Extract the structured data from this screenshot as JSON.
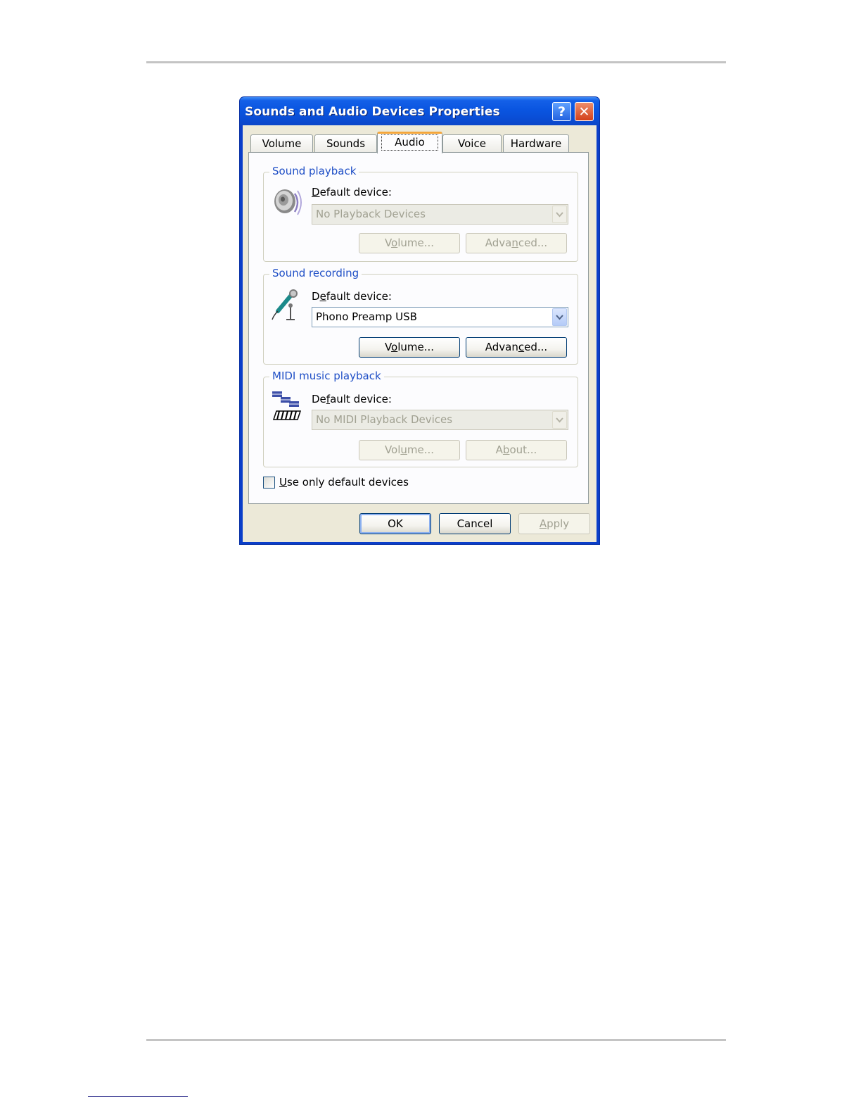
{
  "window": {
    "title": "Sounds and Audio Devices Properties",
    "help_glyph": "?",
    "close_glyph": "✕"
  },
  "tabs": [
    {
      "label": "Volume"
    },
    {
      "label": "Sounds"
    },
    {
      "label": "Audio",
      "active": true
    },
    {
      "label": "Voice"
    },
    {
      "label": "Hardware"
    }
  ],
  "sound_playback": {
    "title": "Sound playback",
    "icon": "speaker-icon",
    "label_mnemonic": "D",
    "label_rest": "efault device:",
    "device": "No Playback Devices",
    "volume_pre": "V",
    "volume_mnemonic": "o",
    "volume_post": "lume...",
    "advanced_pre": "Adva",
    "advanced_mnemonic": "n",
    "advanced_post": "ced...",
    "enabled": false
  },
  "sound_recording": {
    "title": "Sound recording",
    "icon": "microphone-icon",
    "label_pre": "D",
    "label_mnemonic": "e",
    "label_post": "fault device:",
    "device": "Phono Preamp USB",
    "volume_pre": "V",
    "volume_mnemonic": "o",
    "volume_post": "lume...",
    "advanced_pre": "Advan",
    "advanced_mnemonic": "c",
    "advanced_post": "ed...",
    "enabled": true
  },
  "midi_playback": {
    "title": "MIDI music playback",
    "icon": "midi-keyboard-icon",
    "label_pre": "De",
    "label_mnemonic": "f",
    "label_post": "ault device:",
    "device": "No MIDI Playback Devices",
    "volume_pre": "Vol",
    "volume_mnemonic": "u",
    "volume_post": "me...",
    "about_pre": "A",
    "about_mnemonic": "b",
    "about_post": "out...",
    "enabled": false
  },
  "use_only_default": {
    "mnemonic": "U",
    "label_rest": "se only default devices",
    "checked": false
  },
  "buttons": {
    "ok": "OK",
    "cancel": "Cancel",
    "apply_mnemonic": "A",
    "apply_rest": "pply"
  },
  "colors": {
    "title_bar": "#0a55e0",
    "group_title": "#1f4fc6",
    "active_tab_accent": "#f4a63b",
    "dialog_face": "#ece9d8"
  }
}
